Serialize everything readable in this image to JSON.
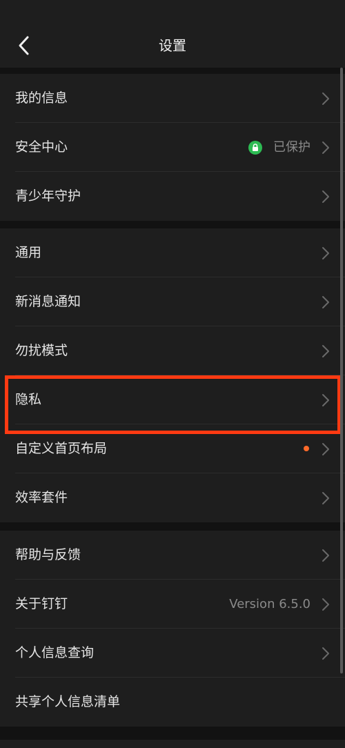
{
  "header": {
    "title": "设置",
    "back_icon": "chevron-left-icon"
  },
  "groups": [
    {
      "items": [
        {
          "label": "我的信息"
        },
        {
          "label": "安全中心",
          "status": "已保护",
          "status_icon": "lock-icon",
          "status_color": "#2dbb53"
        },
        {
          "label": "青少年守护"
        }
      ]
    },
    {
      "items": [
        {
          "label": "通用"
        },
        {
          "label": "新消息通知"
        },
        {
          "label": "勿扰模式"
        },
        {
          "label": "隐私",
          "highlighted": true
        },
        {
          "label": "自定义首页布局",
          "badge": "dot",
          "badge_color": "#ff6a2a"
        },
        {
          "label": "效率套件"
        }
      ]
    },
    {
      "items": [
        {
          "label": "帮助与反馈"
        },
        {
          "label": "关于钉钉",
          "value": "Version 6.5.0"
        },
        {
          "label": "个人信息查询"
        },
        {
          "label": "共享个人信息清单"
        }
      ]
    }
  ],
  "colors": {
    "background": "#121212",
    "surface": "#1e1e1e",
    "highlight_border": "#ff3a12"
  }
}
